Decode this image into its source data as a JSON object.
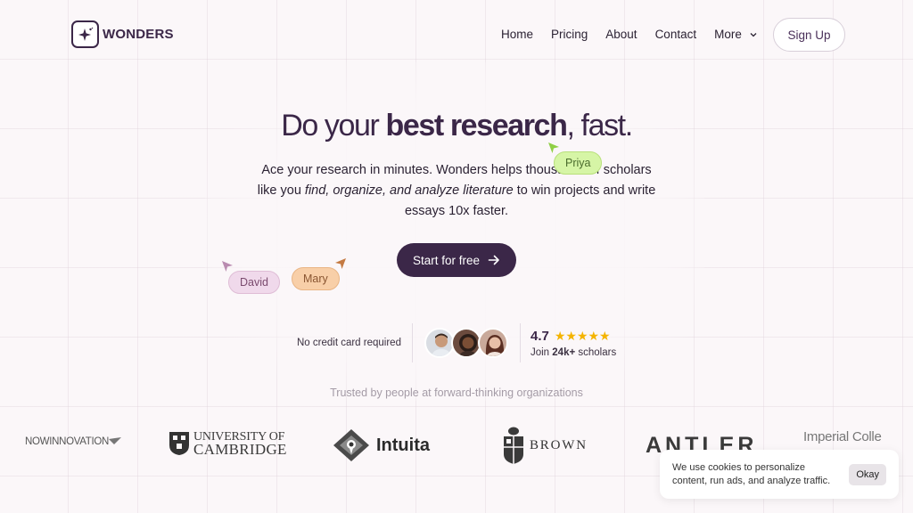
{
  "brand": {
    "name": "WONDERS",
    "accent": "#3b2748"
  },
  "nav": {
    "items": [
      "Home",
      "Pricing",
      "About",
      "Contact",
      "More"
    ],
    "signup": "Sign Up"
  },
  "hero": {
    "headline_pre": "Do your ",
    "headline_bold": "best research",
    "headline_post": ", fast.",
    "sub_1": "Ace your research in minutes. Wonders helps thousands of scholars like you ",
    "sub_italic": "find, organize, and analyze literature",
    "sub_2": " to win projects and write essays 10x faster.",
    "cta": "Start for free"
  },
  "cursors": [
    {
      "name": "Priya",
      "bg": "#d6f5a6",
      "fg": "#4a6b2c",
      "arrow": "#8fcf45"
    },
    {
      "name": "David",
      "bg": "#f0d9eb",
      "fg": "#7a4a6e",
      "arrow": "#b98bb0"
    },
    {
      "name": "Mary",
      "bg": "#f8cfa8",
      "fg": "#8a5632",
      "arrow": "#c47a42"
    }
  ],
  "proof": {
    "no_card": "No credit card required",
    "rating": "4.7",
    "stars": "★★★★★",
    "join_pre": "Join ",
    "join_bold": "24k+",
    "join_post": " scholars"
  },
  "trusted": "Trusted by people at forward-thinking organizations",
  "orgs": [
    "NOWINNOVATION",
    "UNIVERSITY OF",
    "CAMBRIDGE",
    "Intuita",
    "BROWN",
    "ANTLER",
    "Imperial Colle"
  ],
  "cookie": {
    "message": "We use cookies to personalize content, run ads, and analyze traffic.",
    "ok": "Okay"
  }
}
